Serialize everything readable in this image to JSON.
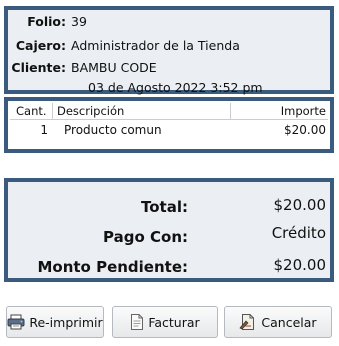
{
  "info": {
    "folio_label": "Folio:",
    "folio_value": "39",
    "cajero_label": "Cajero:",
    "cajero_value": "Administrador de la Tienda",
    "cliente_label": "Cliente:",
    "cliente_value": "BAMBU CODE",
    "date": "03 de Agosto 2022 3:52 pm"
  },
  "items": {
    "columns": [
      "Cant.",
      "Descripción",
      "Importe"
    ],
    "rows": [
      {
        "qty": "1",
        "description": "Producto comun",
        "amount": "$20.00"
      }
    ]
  },
  "totals": {
    "total_label": "Total:",
    "total_value": "$20.00",
    "pago_label": "Pago Con:",
    "pago_value": "Crédito",
    "pendiente_label": "Monto Pendiente:",
    "pendiente_value": "$20.00"
  },
  "buttons": {
    "reprint": "Re-imprimir",
    "invoice": "Facturar",
    "cancel": "Cancelar"
  },
  "colors": {
    "panel_border": "#3a5a7e",
    "panel_fill": "#ebeff4"
  },
  "icons": [
    "printer-icon",
    "document-icon",
    "cancel-document-icon"
  ]
}
